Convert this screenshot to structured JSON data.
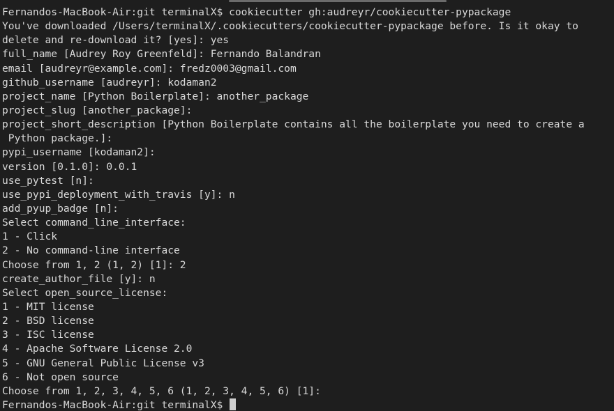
{
  "terminal": {
    "lines": [
      "Fernandos-MacBook-Air:git terminalX$ cookiecutter gh:audreyr/cookiecutter-pypackage",
      "You've downloaded /Users/terminalX/.cookiecutters/cookiecutter-pypackage before. Is it okay to",
      "delete and re-download it? [yes]: yes",
      "full_name [Audrey Roy Greenfeld]: Fernando Balandran",
      "email [audreyr@example.com]: fredz0003@gmail.com",
      "github_username [audreyr]: kodaman2",
      "project_name [Python Boilerplate]: another_package",
      "project_slug [another_package]:",
      "project_short_description [Python Boilerplate contains all the boilerplate you need to create a",
      " Python package.]:",
      "pypi_username [kodaman2]:",
      "version [0.1.0]: 0.0.1",
      "use_pytest [n]:",
      "use_pypi_deployment_with_travis [y]: n",
      "add_pyup_badge [n]:",
      "Select command_line_interface:",
      "1 - Click",
      "2 - No command-line interface",
      "Choose from 1, 2 (1, 2) [1]: 2",
      "create_author_file [y]: n",
      "Select open_source_license:",
      "1 - MIT license",
      "2 - BSD license",
      "3 - ISC license",
      "4 - Apache Software License 2.0",
      "5 - GNU General Public License v3",
      "6 - Not open source",
      "Choose from 1, 2, 3, 4, 5, 6 (1, 2, 3, 4, 5, 6) [1]:"
    ],
    "prompt": "Fernandos-MacBook-Air:git terminalX$ "
  }
}
